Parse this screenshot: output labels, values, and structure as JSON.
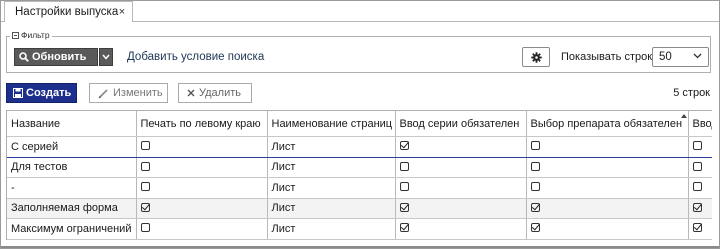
{
  "tab": {
    "label": "Настройки выпуска",
    "close": "×"
  },
  "filter": {
    "legend": "Фильтр",
    "refresh_label": "Обновить",
    "add_condition": "Добавить условие поиска",
    "show_rows_label": "Показывать строк",
    "rows_value": "50"
  },
  "toolbar": {
    "create_label": "Создать",
    "edit_label": "Изменить",
    "delete_label": "Удалить",
    "row_count": "5 строк"
  },
  "table": {
    "columns": [
      "Название",
      "Печать по левому краю",
      "Наименование страниц",
      "Ввод серии обязателен",
      "Выбор препарата обязателен",
      "Ввод"
    ],
    "rows": [
      {
        "name": "С серией",
        "left_print": false,
        "pages": "Лист",
        "series_req": true,
        "drug_req": false,
        "input": false
      },
      {
        "name": "Для тестов",
        "left_print": false,
        "pages": "Лист",
        "series_req": false,
        "drug_req": false,
        "input": false
      },
      {
        "name": "-",
        "left_print": false,
        "pages": "Лист",
        "series_req": false,
        "drug_req": false,
        "input": false
      },
      {
        "name": "Заполняемая форма",
        "left_print": true,
        "pages": "Лист",
        "series_req": true,
        "drug_req": true,
        "input": true
      },
      {
        "name": "Максимум ограничений",
        "left_print": false,
        "pages": "Лист",
        "series_req": true,
        "drug_req": true,
        "input": true
      }
    ]
  }
}
